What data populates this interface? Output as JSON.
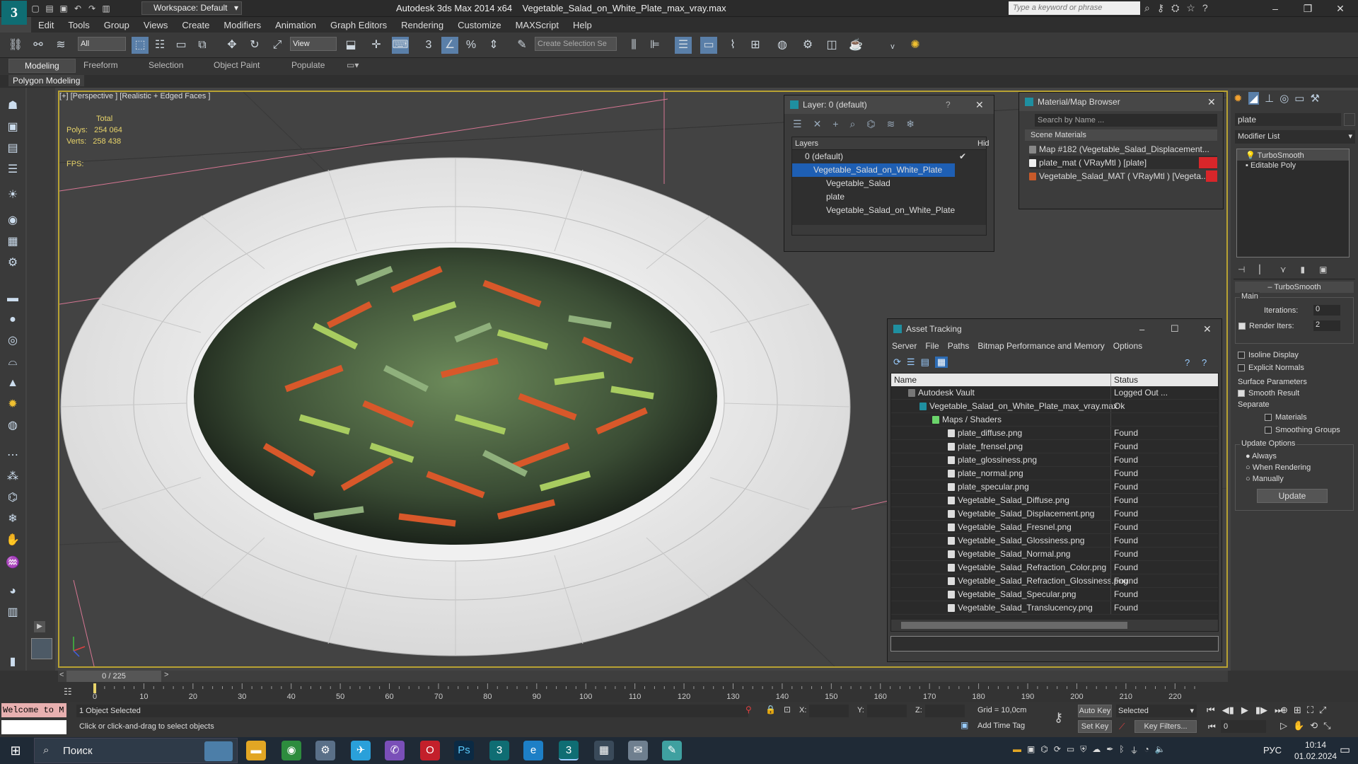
{
  "window": {
    "app_title": "Autodesk 3ds Max  2014 x64",
    "file_title": "Vegetable_Salad_on_White_Plate_max_vray.max",
    "workspace": "Workspace: Default",
    "search_placeholder": "Type a keyword or phrase"
  },
  "menu": [
    "Edit",
    "Tools",
    "Group",
    "Views",
    "Create",
    "Modifiers",
    "Animation",
    "Graph Editors",
    "Rendering",
    "Customize",
    "MAXScript",
    "Help"
  ],
  "toolbar": {
    "selection_filter": "All",
    "ref_coord": "View",
    "selection_set_placeholder": "Create Selection Se"
  },
  "ribbon": {
    "tabs": [
      "Modeling",
      "Freeform",
      "Selection",
      "Object Paint",
      "Populate"
    ],
    "sub_tag": "Polygon Modeling"
  },
  "viewport": {
    "label": "[+] [Perspective ] [Realistic + Edged Faces ]",
    "stats_header": "Total",
    "polys_label": "Polys:",
    "polys_value": "254 064",
    "verts_label": "Verts:",
    "verts_value": "258 438",
    "fps_label": "FPS:"
  },
  "layer_dialog": {
    "title": "Layer: 0 (default)",
    "col_layers": "Layers",
    "col_hide": "Hid",
    "rows": [
      "0 (default)",
      "Vegetable_Salad_on_White_Plate",
      "Vegetable_Salad",
      "plate",
      "Vegetable_Salad_on_White_Plate"
    ]
  },
  "material_browser": {
    "title": "Material/Map Browser",
    "search_placeholder": "Search by Name ...",
    "section": "Scene Materials",
    "items": [
      "Map #182 (Vegetable_Salad_Displacement...",
      "plate_mat  ( VRayMtl ) [plate]",
      "Vegetable_Salad_MAT  ( VRayMtl ) [Vegeta..."
    ]
  },
  "asset_tracking": {
    "title": "Asset Tracking",
    "menu": [
      "Server",
      "File",
      "Paths",
      "Bitmap Performance and Memory",
      "Options"
    ],
    "col_name": "Name",
    "col_status": "Status",
    "rows": [
      {
        "name": "Autodesk Vault",
        "status": "Logged Out ..."
      },
      {
        "name": "Vegetable_Salad_on_White_Plate_max_vray.max",
        "status": "Ok"
      },
      {
        "name": "Maps / Shaders",
        "status": ""
      },
      {
        "name": "plate_diffuse.png",
        "status": "Found"
      },
      {
        "name": "plate_frensel.png",
        "status": "Found"
      },
      {
        "name": "plate_glossiness.png",
        "status": "Found"
      },
      {
        "name": "plate_normal.png",
        "status": "Found"
      },
      {
        "name": "plate_specular.png",
        "status": "Found"
      },
      {
        "name": "Vegetable_Salad_Diffuse.png",
        "status": "Found"
      },
      {
        "name": "Vegetable_Salad_Displacement.png",
        "status": "Found"
      },
      {
        "name": "Vegetable_Salad_Fresnel.png",
        "status": "Found"
      },
      {
        "name": "Vegetable_Salad_Glossiness.png",
        "status": "Found"
      },
      {
        "name": "Vegetable_Salad_Normal.png",
        "status": "Found"
      },
      {
        "name": "Vegetable_Salad_Refraction_Color.png",
        "status": "Found"
      },
      {
        "name": "Vegetable_Salad_Refraction_Glossiness.png",
        "status": "Found"
      },
      {
        "name": "Vegetable_Salad_Specular.png",
        "status": "Found"
      },
      {
        "name": "Vegetable_Salad_Translucency.png",
        "status": "Found"
      }
    ]
  },
  "command_panel": {
    "name_field": "plate",
    "modifier_list": "Modifier List",
    "stack": [
      "TurboSmooth",
      "Editable Poly"
    ],
    "rollout_title": "TurboSmooth",
    "main_label": "Main",
    "iterations_label": "Iterations:",
    "iterations_value": "0",
    "render_iters_label": "Render Iters:",
    "render_iters_value": "2",
    "isoline": "Isoline Display",
    "explicit_normals": "Explicit Normals",
    "surface_params": "Surface Parameters",
    "smooth_result": "Smooth Result",
    "separate": "Separate",
    "materials": "Materials",
    "smoothing_groups": "Smoothing Groups",
    "update_options": "Update Options",
    "always": "Always",
    "when_rendering": "When Rendering",
    "manually": "Manually",
    "update_button": "Update"
  },
  "timeline": {
    "frame_counter": "0 / 225",
    "ticks": [
      "0",
      "10",
      "20",
      "30",
      "40",
      "50",
      "60",
      "70",
      "80",
      "90",
      "100",
      "110",
      "120",
      "130",
      "140",
      "150",
      "160",
      "170",
      "180",
      "190",
      "200",
      "210",
      "220"
    ]
  },
  "status": {
    "maxscript": "Welcome to M",
    "selected": "1 Object Selected",
    "prompt": "Click or click-and-drag to select objects",
    "x_label": "X:",
    "y_label": "Y:",
    "z_label": "Z:",
    "grid": "Grid = 10,0cm",
    "add_time_tag": "Add Time Tag",
    "auto_key": "Auto Key",
    "set_key": "Set Key",
    "selected_dropdown": "Selected",
    "key_filters": "Key Filters...",
    "frame_field": "0"
  },
  "taskbar": {
    "search": "Поиск",
    "lang": "РУС",
    "time": "10:14",
    "date": "01.02.2024"
  },
  "colors": {
    "accent": "#0f6d73",
    "viewport_border": "#b8a232",
    "selection": "#1e5fb4"
  }
}
